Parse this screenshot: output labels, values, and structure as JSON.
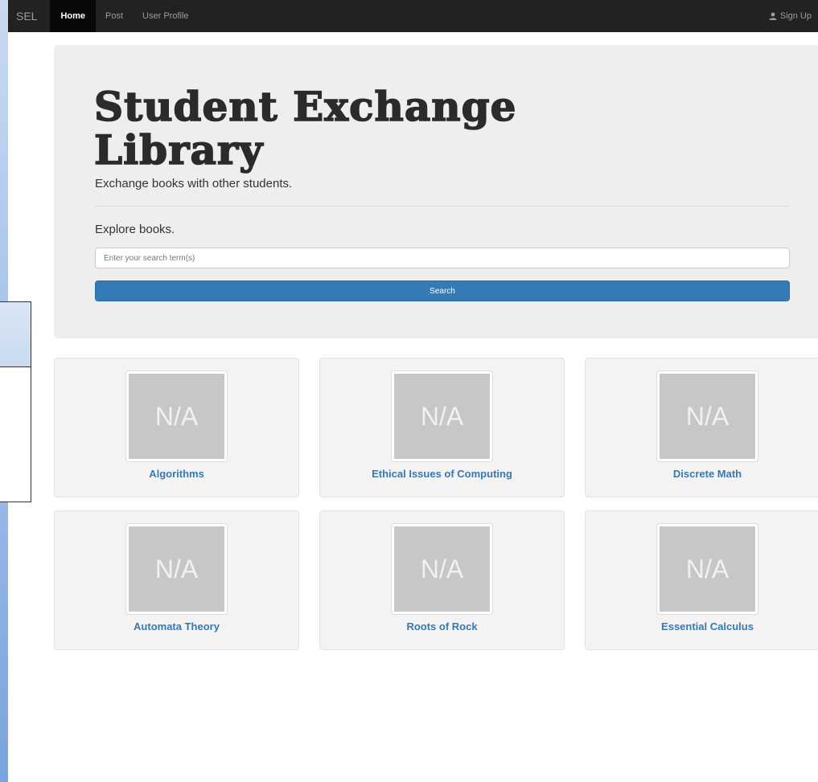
{
  "navbar": {
    "brand": "SEL",
    "items": [
      {
        "label": "Home"
      },
      {
        "label": "Post"
      },
      {
        "label": "User Profile"
      }
    ],
    "signup_label": "Sign Up",
    "signup_icon": "user-icon"
  },
  "hero": {
    "title_line1": "Student Exchange",
    "title_line2": "Library",
    "subtitle": "Exchange books with other students.",
    "explore_label": "Explore books.",
    "search_placeholder": "Enter your search term(s)",
    "search_button": "Search"
  },
  "books": [
    {
      "title": "Algorithms",
      "image_text": "N/A"
    },
    {
      "title": "Ethical Issues of Computing",
      "image_text": "N/A"
    },
    {
      "title": "Discrete Math",
      "image_text": "N/A"
    },
    {
      "title": "Automata Theory",
      "image_text": "N/A"
    },
    {
      "title": "Roots of Rock",
      "image_text": "N/A"
    },
    {
      "title": "Essential Calculus",
      "image_text": "N/A"
    }
  ],
  "colors": {
    "navbar_bg": "#222222",
    "jumbotron_bg": "#eeeeee",
    "primary": "#337ab7",
    "card_bg": "#f3f3f3",
    "placeholder_gray": "#c7c7c7"
  }
}
